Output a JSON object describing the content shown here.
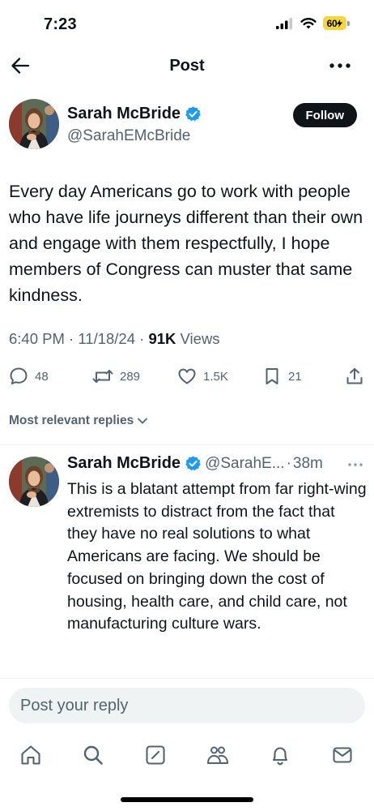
{
  "status_bar": {
    "time": "7:23",
    "battery": "60"
  },
  "header": {
    "title": "Post"
  },
  "post": {
    "author_name": "Sarah McBride",
    "author_handle": "@SarahEMcBride",
    "follow_label": "Follow",
    "text": "Every day Americans go to work with people who have life journeys different than their own and engage with them respectfully, I hope members of Congress can muster that same kindness.",
    "time": "6:40 PM",
    "date": "11/18/24",
    "separator": "·",
    "views_count": "91K",
    "views_label": "Views",
    "stats": {
      "replies": "48",
      "reposts": "289",
      "likes": "1.5K",
      "bookmarks": "21"
    }
  },
  "replies_sort_label": "Most relevant replies",
  "reply": {
    "author_name": "Sarah McBride",
    "author_handle": "@SarahE...",
    "separator": "·",
    "time": "38m",
    "text": "This is a blatant attempt from far right-wing extremists to distract from the fact that they have no real solutions to what Americans are facing. We should be focused on bringing down the cost of housing, health care, and child care, not manufacturing culture wars."
  },
  "reply_box": {
    "placeholder": "Post your reply"
  },
  "tabs": [
    "home-icon",
    "search-icon",
    "compose-icon",
    "communities-icon",
    "notifications-icon",
    "messages-icon"
  ],
  "colors": {
    "text": "#0f1419",
    "secondary": "#536471",
    "verified": "#1d9bf0",
    "battery": "#f4d53c"
  }
}
